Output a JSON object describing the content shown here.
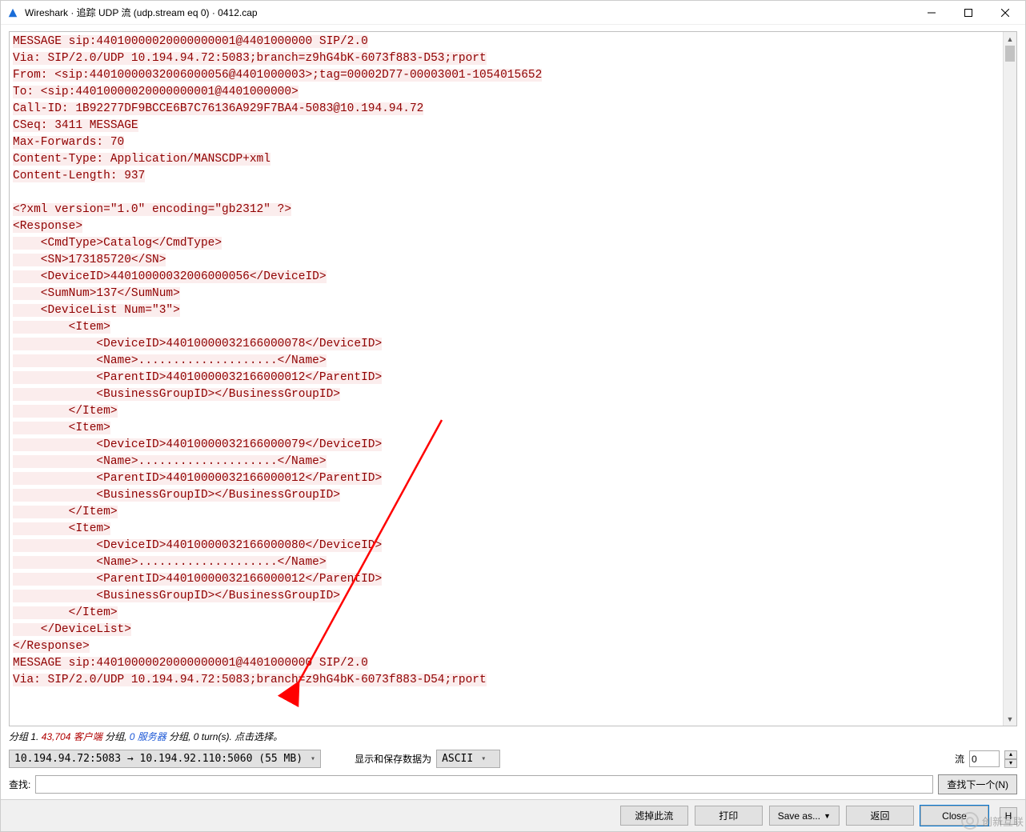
{
  "window": {
    "title": "Wireshark · 追踪 UDP 流 (udp.stream eq 0) · 0412.cap"
  },
  "stream_text": "MESSAGE sip:44010000020000000001@4401000000 SIP/2.0\nVia: SIP/2.0/UDP 10.194.94.72:5083;branch=z9hG4bK-6073f883-D53;rport\nFrom: <sip:44010000032006000056@4401000003>;tag=00002D77-00003001-1054015652\nTo: <sip:44010000020000000001@4401000000>\nCall-ID: 1B92277DF9BCCE6B7C76136A929F7BA4-5083@10.194.94.72\nCSeq: 3411 MESSAGE\nMax-Forwards: 70\nContent-Type: Application/MANSCDP+xml\nContent-Length: 937\n\n<?xml version=\"1.0\" encoding=\"gb2312\" ?>\n<Response>\n    <CmdType>Catalog</CmdType>\n    <SN>173185720</SN>\n    <DeviceID>44010000032006000056</DeviceID>\n    <SumNum>137</SumNum>\n    <DeviceList Num=\"3\">\n        <Item>\n            <DeviceID>44010000032166000078</DeviceID>\n            <Name>....................</Name>\n            <ParentID>44010000032166000012</ParentID>\n            <BusinessGroupID></BusinessGroupID>\n        </Item>\n        <Item>\n            <DeviceID>44010000032166000079</DeviceID>\n            <Name>....................</Name>\n            <ParentID>44010000032166000012</ParentID>\n            <BusinessGroupID></BusinessGroupID>\n        </Item>\n        <Item>\n            <DeviceID>44010000032166000080</DeviceID>\n            <Name>....................</Name>\n            <ParentID>44010000032166000012</ParentID>\n            <BusinessGroupID></BusinessGroupID>\n        </Item>\n    </DeviceList>\n</Response>\nMESSAGE sip:44010000020000000001@4401000000 SIP/2.0\nVia: SIP/2.0/UDP 10.194.94.72:5083;branch=z9hG4bK-6073f883-D54;rport",
  "status": {
    "prefix": "分组 1. ",
    "client_count": "43,704",
    "client_label": " 客户端 ",
    "mid": "分组, ",
    "server_count": "0",
    "server_label": " 服务器 ",
    "suffix": "分组, 0 turn(s). 点击选择。"
  },
  "controls": {
    "endpoint_combo": "10.194.94.72:5083 → 10.194.92.110:5060 (55 MB)",
    "show_save_label": "显示和保存数据为",
    "format_combo": "ASCII",
    "stream_label": "流",
    "stream_value": "0"
  },
  "find": {
    "label": "查找:",
    "value": "",
    "next_button": "查找下一个(N)"
  },
  "buttons": {
    "filter_out": "滤掉此流",
    "print": "打印",
    "save_as": "Save as...",
    "back": "返回",
    "close": "Close",
    "help": "H"
  },
  "watermark": "创新互联"
}
